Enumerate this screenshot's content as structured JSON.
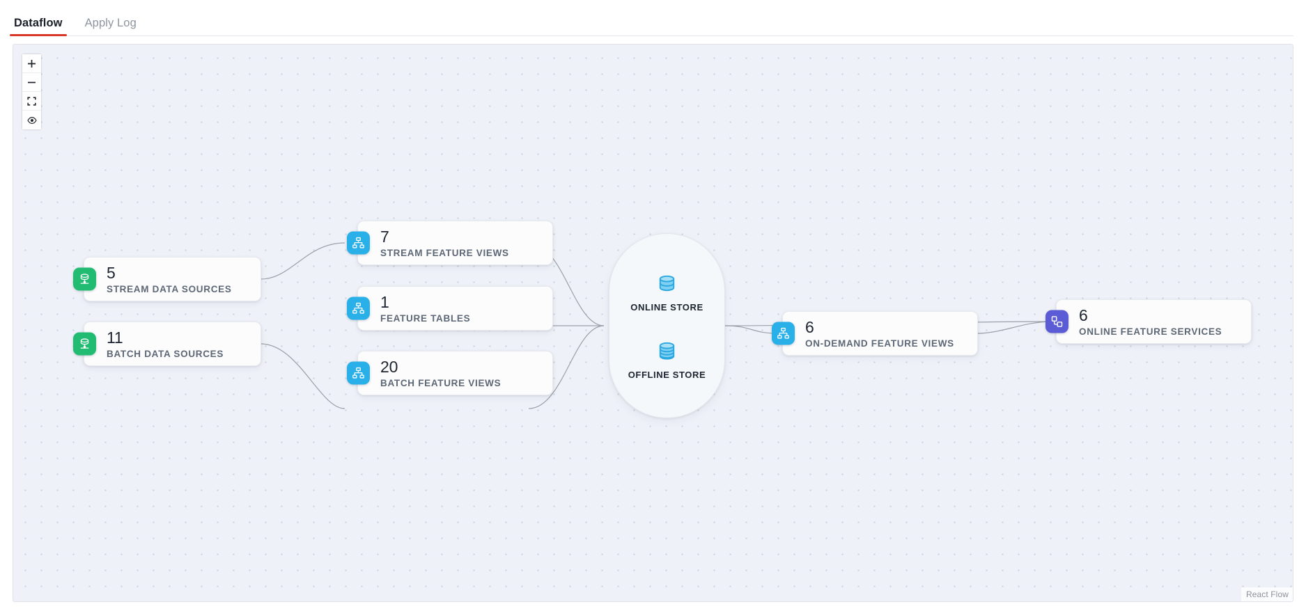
{
  "tabs": [
    {
      "label": "Dataflow",
      "active": true
    },
    {
      "label": "Apply Log",
      "active": false
    }
  ],
  "controls": [
    {
      "name": "zoom-in",
      "icon": "plus-icon",
      "title": "zoom in"
    },
    {
      "name": "zoom-out",
      "icon": "minus-icon",
      "title": "zoom out"
    },
    {
      "name": "fit-view",
      "icon": "fit-view-icon",
      "title": "fit view"
    },
    {
      "name": "toggle-interactivity",
      "icon": "eye-icon",
      "title": "toggle interactivity"
    }
  ],
  "nodes": {
    "stream_data_sources": {
      "count": "5",
      "label": "STREAM DATA SOURCES",
      "color": "#22bb72",
      "icon": "data-source-icon"
    },
    "batch_data_sources": {
      "count": "11",
      "label": "BATCH DATA SOURCES",
      "color": "#22bb72",
      "icon": "data-source-icon"
    },
    "stream_feature_views": {
      "count": "7",
      "label": "STREAM FEATURE VIEWS",
      "color": "#29b0e8",
      "icon": "sitemap-icon"
    },
    "feature_tables": {
      "count": "1",
      "label": "FEATURE TABLES",
      "color": "#29b0e8",
      "icon": "sitemap-icon"
    },
    "batch_feature_views": {
      "count": "20",
      "label": "BATCH FEATURE VIEWS",
      "color": "#29b0e8",
      "icon": "sitemap-icon"
    },
    "on_demand_feature_views": {
      "count": "6",
      "label": "ON-DEMAND FEATURE VIEWS",
      "color": "#29b0e8",
      "icon": "sitemap-icon"
    },
    "online_feature_services": {
      "count": "6",
      "label": "ONLINE FEATURE SERVICES",
      "color": "#5b5bd6",
      "icon": "feature-service-icon"
    }
  },
  "store": {
    "online": {
      "label": "ONLINE STORE",
      "icon": "database-single-icon",
      "color": "#5bc5ef"
    },
    "offline": {
      "label": "OFFLINE STORE",
      "icon": "database-stacked-icon",
      "color": "#5bc5ef"
    }
  },
  "attribution": {
    "label": "React Flow"
  },
  "theme": {
    "accent_red": "#d9372a",
    "canvas_bg": "#eef1f8",
    "edge_stroke": "#9aa0a8",
    "node_bg": "#fcfcfd",
    "label_color": "#5d6775"
  }
}
